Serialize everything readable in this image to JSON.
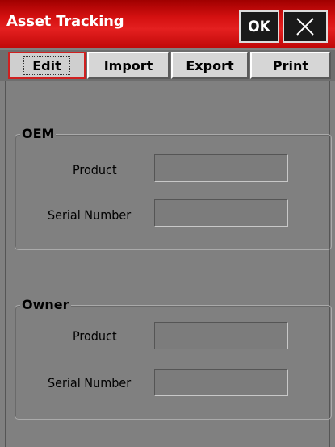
{
  "window": {
    "title": "Asset Tracking",
    "ok_label": "OK",
    "close_icon": "close-icon"
  },
  "tabs": [
    {
      "label": "Edit",
      "active": true
    },
    {
      "label": "Import",
      "active": false
    },
    {
      "label": "Export",
      "active": false
    },
    {
      "label": "Print",
      "active": false
    }
  ],
  "oem": {
    "title": "OEM",
    "product_label": "Product",
    "product_value": "",
    "serial_label": "Serial Number",
    "serial_value": ""
  },
  "owner": {
    "title": "Owner",
    "product_label": "Product",
    "product_value": "",
    "serial_label": "Serial Number",
    "serial_value": ""
  },
  "colors": {
    "titlebar": "#d41010",
    "background": "#808080",
    "active_tab_border": "#d02020"
  }
}
